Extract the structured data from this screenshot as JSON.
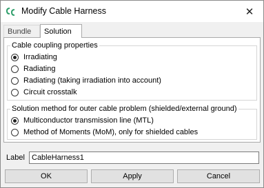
{
  "window": {
    "title": "Modify Cable Harness",
    "close_symbol": "✕",
    "accent_color": "#2e9e6a"
  },
  "tabs": [
    {
      "label": "Bundle",
      "selected": false
    },
    {
      "label": "Solution",
      "selected": true
    }
  ],
  "coupling_group": {
    "title": "Cable coupling properties",
    "options": [
      {
        "label": "Irradiating",
        "checked": true
      },
      {
        "label": "Radiating",
        "checked": false
      },
      {
        "label": "Radiating (taking irradiation into account)",
        "checked": false
      },
      {
        "label": "Circuit crosstalk",
        "checked": false
      }
    ]
  },
  "solution_group": {
    "title": "Solution method for outer cable problem (shielded/external ground)",
    "options": [
      {
        "label": "Multiconductor transmission line (MTL)",
        "checked": true
      },
      {
        "label": "Method of Moments (MoM), only for shielded cables",
        "checked": false
      }
    ]
  },
  "label_field": {
    "label": "Label",
    "value": "CableHarness1"
  },
  "buttons": {
    "ok": "OK",
    "apply": "Apply",
    "cancel": "Cancel"
  }
}
